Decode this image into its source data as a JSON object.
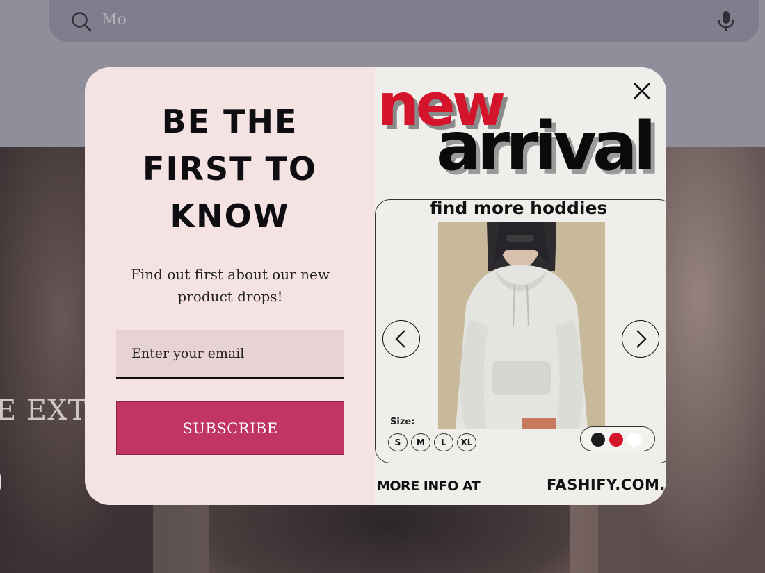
{
  "search": {
    "value": "Mo",
    "icon": "search-icon",
    "mic_icon": "microphone-icon"
  },
  "background": {
    "hero_text": "E EXTI"
  },
  "popup": {
    "headline_line1": "BE THE",
    "headline_line2": "FIRST TO",
    "headline_line3": "KNOW",
    "subtext": "Find out first about our new product drops!",
    "email_placeholder": "Enter your email",
    "subscribe_label": "SUBSCRIBE",
    "close_icon": "close-icon",
    "accent_color": "#c13563"
  },
  "ad": {
    "new_label": "new",
    "arrival_label": "arrival",
    "find_more": "find more hoddies",
    "size_label": "Size:",
    "sizes": [
      "S",
      "M",
      "L",
      "XL"
    ],
    "colors": [
      "#1c1a1a",
      "#d4142a",
      "#ffffff"
    ],
    "more_info": "MORE INFO AT",
    "site": "FASHIFY.COM.C",
    "new_color": "#d4142a"
  }
}
